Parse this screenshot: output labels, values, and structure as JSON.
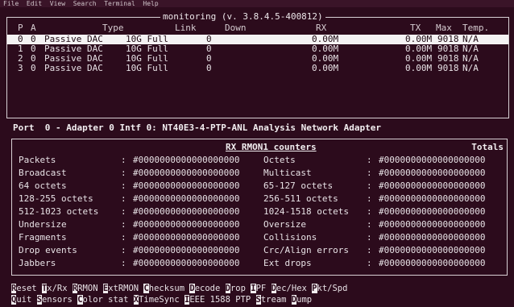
{
  "menubar": "File  Edit  View  Search  Terminal  Help",
  "monitor": {
    "title": "monitoring (v. 3.8.4.5-400812)",
    "headers": [
      "P",
      "A",
      "Type",
      "Link",
      "Down",
      "RX",
      "TX",
      "Max",
      "Temp."
    ],
    "ports": [
      [
        "0",
        "0",
        "Passive DAC",
        "10G Full",
        "0",
        "0.00M",
        "0.00M",
        "9018",
        "N/A"
      ],
      [
        "1",
        "0",
        "Passive DAC",
        "10G Full",
        "0",
        "0.00M",
        "0.00M",
        "9018",
        "N/A"
      ],
      [
        "2",
        "0",
        "Passive DAC",
        "10G Full",
        "0",
        "0.00M",
        "0.00M",
        "9018",
        "N/A"
      ],
      [
        "3",
        "0",
        "Passive DAC",
        "10G Full",
        "0",
        "0.00M",
        "0.00M",
        "9018",
        "N/A"
      ]
    ]
  },
  "adapter_line": "Port  0 - Adapter 0 Intf 0: NT40E3-4-PTP-ANL Analysis Network Adapter",
  "counters": {
    "title": "RX RMON1 counters",
    "totals": "Totals",
    "rows": [
      [
        "Packets",
        ":",
        "#0000000000000000000",
        "Octets",
        ":",
        "#0000000000000000000"
      ],
      [
        "Broadcast",
        ":",
        "#0000000000000000000",
        "Multicast",
        ":",
        "#0000000000000000000"
      ],
      [
        "64 octets",
        ":",
        "#0000000000000000000",
        "65-127 octets",
        ":",
        "#0000000000000000000"
      ],
      [
        "128-255 octets",
        ":",
        "#0000000000000000000",
        "256-511 octets",
        ":",
        "#0000000000000000000"
      ],
      [
        "512-1023 octets",
        ":",
        "#0000000000000000000",
        "1024-1518 octets",
        ":",
        "#0000000000000000000"
      ],
      [
        "Undersize",
        ":",
        "#0000000000000000000",
        "Oversize",
        ":",
        "#0000000000000000000"
      ],
      [
        "Fragments",
        ":",
        "#0000000000000000000",
        "Collisions",
        ":",
        "#0000000000000000000"
      ],
      [
        "Drop events",
        ":",
        "#0000000000000000000",
        "Crc/Align errors",
        ":",
        "#0000000000000000000"
      ],
      [
        "Jabbers",
        ":",
        "#0000000000000000000",
        "Ext drops",
        ":",
        "#0000000000000000000"
      ]
    ]
  },
  "keys_row1": [
    {
      "k": "R",
      "rest": "eset"
    },
    {
      "k": "T",
      "rest": "x/Rx"
    },
    {
      "k": "R",
      "rest": "RMON"
    },
    {
      "k": "E",
      "rest": "xtRMON"
    },
    {
      "k": "C",
      "rest": "hecksum"
    },
    {
      "k": "D",
      "rest": "ecode"
    },
    {
      "k": "D",
      "rest": "rop"
    },
    {
      "k": "I",
      "rest": "PF"
    },
    {
      "k": "D",
      "rest": "ec/Hex"
    },
    {
      "k": "P",
      "rest": "kt/Spd"
    }
  ],
  "keys_row2": [
    {
      "k": "Q",
      "rest": "uit"
    },
    {
      "k": "S",
      "rest": "ensors"
    },
    {
      "k": "C",
      "rest": "olor stat"
    },
    {
      "k": "X",
      "rest": "TimeSync"
    },
    {
      "k": "I",
      "rest": "EEE 1588 PTP"
    },
    {
      "k": "S",
      "rest": "tream"
    },
    {
      "k": "D",
      "rest": "ump"
    }
  ],
  "colors": {
    "background": "#2c0b1c",
    "selection": "#f4f2f3",
    "text": "#e8e2e6"
  }
}
